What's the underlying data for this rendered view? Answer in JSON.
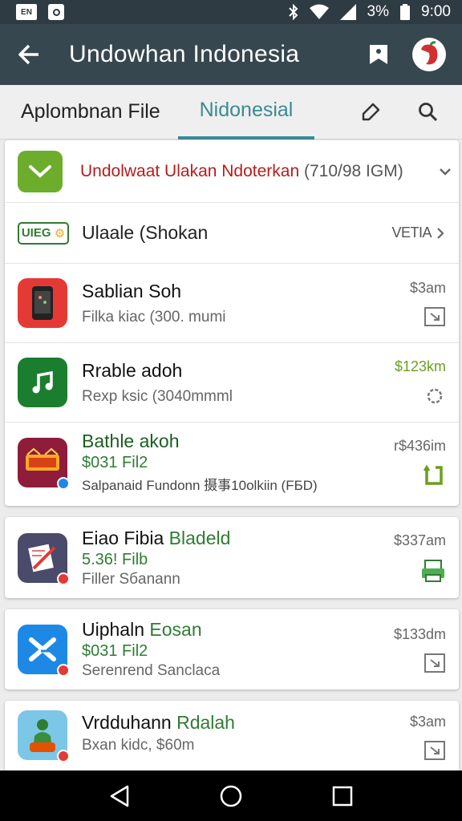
{
  "status": {
    "left_badge": "EN",
    "battery": "3%",
    "time": "9:00"
  },
  "appbar": {
    "title": "Undowhan Indonesia",
    "icons": [
      "back-arrow-icon",
      "bookmark-icon",
      "avatar"
    ]
  },
  "tabs": [
    {
      "label": "Aplombnan File",
      "active": false
    },
    {
      "label": "Nidonesial",
      "active": true
    }
  ],
  "banner": {
    "title": "Undolwaat Ulakan Ndoterkan",
    "size": "(710/98 IGM)"
  },
  "category": {
    "badge": "UIEG",
    "label": "Ulaale (Shokan",
    "more": "VETIA"
  },
  "apps": [
    {
      "name": "Sablian Soh",
      "accent": "",
      "price": "",
      "detail": "Filka kiac (300. mumi",
      "time": "$3am",
      "time_green": false,
      "icon_color": "#e53935",
      "action_icon": "download-icon"
    },
    {
      "name": "Rrable adoh",
      "accent": "",
      "price": "",
      "detail": "Rexp ksic (3040mmml",
      "time": "$123km",
      "time_green": true,
      "icon_color": "#1b7e2f",
      "action_icon": "settings-icon"
    },
    {
      "name": "Bathle akoh",
      "accent": "",
      "price": "$031 Fil2",
      "detail": "Salpanaid Fundonn 摄事10olkiin (FБD)",
      "time": "r$436im",
      "time_green": false,
      "icon_color": "#8e1c3a",
      "action_icon": "refresh-icon"
    },
    {
      "name": "Eiao Fibia ",
      "accent": "Bladeld",
      "price": "5.36! Filb",
      "detail": "Filler Sбanann",
      "time": "$337am",
      "time_green": false,
      "icon_color": "#4a4a6a",
      "action_icon": "printer-icon"
    },
    {
      "name": "Uiphaln ",
      "accent": "Eosan",
      "price": "$031 Fil2",
      "detail": "Serenrend Sanclaca",
      "time": "$133dm",
      "time_green": false,
      "icon_color": "#1e88e5",
      "action_icon": "download-icon"
    },
    {
      "name": "Vrdduhann ",
      "accent": "Rdalah",
      "price": "",
      "detail": "Bxan kidc, $60m",
      "time": "$3am",
      "time_green": false,
      "icon_color": "#7cc6e8",
      "action_icon": "download-icon"
    }
  ],
  "colors": {
    "appbar": "#37474f",
    "statusbar": "#2f3b43",
    "accent_tab": "#3a8a94",
    "green": "#2e7d32",
    "banner_red": "#b71c1c"
  }
}
